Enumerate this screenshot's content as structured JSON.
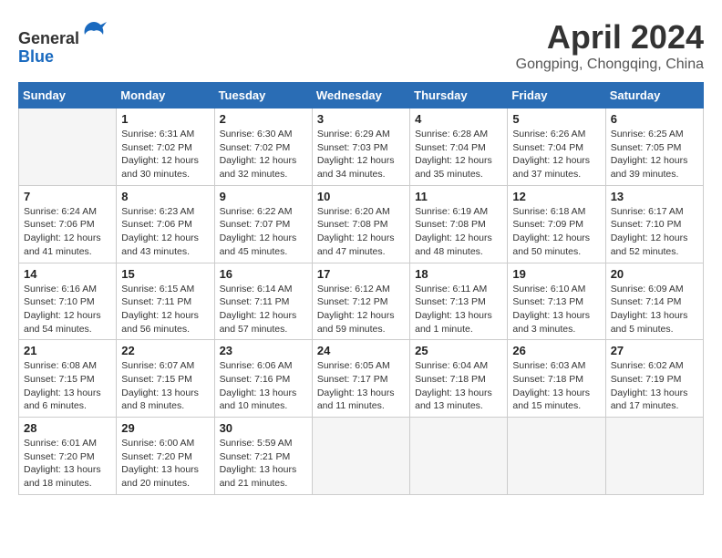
{
  "header": {
    "logo_line1": "General",
    "logo_line2": "Blue",
    "month": "April 2024",
    "location": "Gongping, Chongqing, China"
  },
  "days_of_week": [
    "Sunday",
    "Monday",
    "Tuesday",
    "Wednesday",
    "Thursday",
    "Friday",
    "Saturday"
  ],
  "weeks": [
    [
      {
        "day": "",
        "info": []
      },
      {
        "day": "1",
        "info": [
          "Sunrise: 6:31 AM",
          "Sunset: 7:02 PM",
          "Daylight: 12 hours",
          "and 30 minutes."
        ]
      },
      {
        "day": "2",
        "info": [
          "Sunrise: 6:30 AM",
          "Sunset: 7:02 PM",
          "Daylight: 12 hours",
          "and 32 minutes."
        ]
      },
      {
        "day": "3",
        "info": [
          "Sunrise: 6:29 AM",
          "Sunset: 7:03 PM",
          "Daylight: 12 hours",
          "and 34 minutes."
        ]
      },
      {
        "day": "4",
        "info": [
          "Sunrise: 6:28 AM",
          "Sunset: 7:04 PM",
          "Daylight: 12 hours",
          "and 35 minutes."
        ]
      },
      {
        "day": "5",
        "info": [
          "Sunrise: 6:26 AM",
          "Sunset: 7:04 PM",
          "Daylight: 12 hours",
          "and 37 minutes."
        ]
      },
      {
        "day": "6",
        "info": [
          "Sunrise: 6:25 AM",
          "Sunset: 7:05 PM",
          "Daylight: 12 hours",
          "and 39 minutes."
        ]
      }
    ],
    [
      {
        "day": "7",
        "info": [
          "Sunrise: 6:24 AM",
          "Sunset: 7:06 PM",
          "Daylight: 12 hours",
          "and 41 minutes."
        ]
      },
      {
        "day": "8",
        "info": [
          "Sunrise: 6:23 AM",
          "Sunset: 7:06 PM",
          "Daylight: 12 hours",
          "and 43 minutes."
        ]
      },
      {
        "day": "9",
        "info": [
          "Sunrise: 6:22 AM",
          "Sunset: 7:07 PM",
          "Daylight: 12 hours",
          "and 45 minutes."
        ]
      },
      {
        "day": "10",
        "info": [
          "Sunrise: 6:20 AM",
          "Sunset: 7:08 PM",
          "Daylight: 12 hours",
          "and 47 minutes."
        ]
      },
      {
        "day": "11",
        "info": [
          "Sunrise: 6:19 AM",
          "Sunset: 7:08 PM",
          "Daylight: 12 hours",
          "and 48 minutes."
        ]
      },
      {
        "day": "12",
        "info": [
          "Sunrise: 6:18 AM",
          "Sunset: 7:09 PM",
          "Daylight: 12 hours",
          "and 50 minutes."
        ]
      },
      {
        "day": "13",
        "info": [
          "Sunrise: 6:17 AM",
          "Sunset: 7:10 PM",
          "Daylight: 12 hours",
          "and 52 minutes."
        ]
      }
    ],
    [
      {
        "day": "14",
        "info": [
          "Sunrise: 6:16 AM",
          "Sunset: 7:10 PM",
          "Daylight: 12 hours",
          "and 54 minutes."
        ]
      },
      {
        "day": "15",
        "info": [
          "Sunrise: 6:15 AM",
          "Sunset: 7:11 PM",
          "Daylight: 12 hours",
          "and 56 minutes."
        ]
      },
      {
        "day": "16",
        "info": [
          "Sunrise: 6:14 AM",
          "Sunset: 7:11 PM",
          "Daylight: 12 hours",
          "and 57 minutes."
        ]
      },
      {
        "day": "17",
        "info": [
          "Sunrise: 6:12 AM",
          "Sunset: 7:12 PM",
          "Daylight: 12 hours",
          "and 59 minutes."
        ]
      },
      {
        "day": "18",
        "info": [
          "Sunrise: 6:11 AM",
          "Sunset: 7:13 PM",
          "Daylight: 13 hours",
          "and 1 minute."
        ]
      },
      {
        "day": "19",
        "info": [
          "Sunrise: 6:10 AM",
          "Sunset: 7:13 PM",
          "Daylight: 13 hours",
          "and 3 minutes."
        ]
      },
      {
        "day": "20",
        "info": [
          "Sunrise: 6:09 AM",
          "Sunset: 7:14 PM",
          "Daylight: 13 hours",
          "and 5 minutes."
        ]
      }
    ],
    [
      {
        "day": "21",
        "info": [
          "Sunrise: 6:08 AM",
          "Sunset: 7:15 PM",
          "Daylight: 13 hours",
          "and 6 minutes."
        ]
      },
      {
        "day": "22",
        "info": [
          "Sunrise: 6:07 AM",
          "Sunset: 7:15 PM",
          "Daylight: 13 hours",
          "and 8 minutes."
        ]
      },
      {
        "day": "23",
        "info": [
          "Sunrise: 6:06 AM",
          "Sunset: 7:16 PM",
          "Daylight: 13 hours",
          "and 10 minutes."
        ]
      },
      {
        "day": "24",
        "info": [
          "Sunrise: 6:05 AM",
          "Sunset: 7:17 PM",
          "Daylight: 13 hours",
          "and 11 minutes."
        ]
      },
      {
        "day": "25",
        "info": [
          "Sunrise: 6:04 AM",
          "Sunset: 7:18 PM",
          "Daylight: 13 hours",
          "and 13 minutes."
        ]
      },
      {
        "day": "26",
        "info": [
          "Sunrise: 6:03 AM",
          "Sunset: 7:18 PM",
          "Daylight: 13 hours",
          "and 15 minutes."
        ]
      },
      {
        "day": "27",
        "info": [
          "Sunrise: 6:02 AM",
          "Sunset: 7:19 PM",
          "Daylight: 13 hours",
          "and 17 minutes."
        ]
      }
    ],
    [
      {
        "day": "28",
        "info": [
          "Sunrise: 6:01 AM",
          "Sunset: 7:20 PM",
          "Daylight: 13 hours",
          "and 18 minutes."
        ]
      },
      {
        "day": "29",
        "info": [
          "Sunrise: 6:00 AM",
          "Sunset: 7:20 PM",
          "Daylight: 13 hours",
          "and 20 minutes."
        ]
      },
      {
        "day": "30",
        "info": [
          "Sunrise: 5:59 AM",
          "Sunset: 7:21 PM",
          "Daylight: 13 hours",
          "and 21 minutes."
        ]
      },
      {
        "day": "",
        "info": []
      },
      {
        "day": "",
        "info": []
      },
      {
        "day": "",
        "info": []
      },
      {
        "day": "",
        "info": []
      }
    ]
  ]
}
